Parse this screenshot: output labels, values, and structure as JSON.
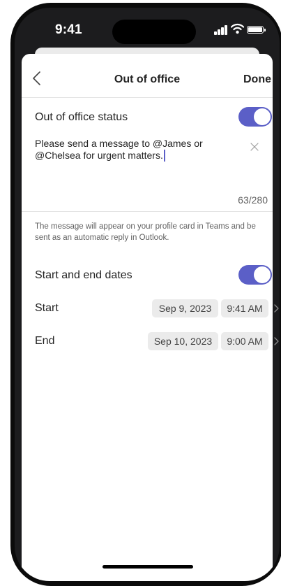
{
  "status_bar": {
    "time": "9:41",
    "icons": [
      "signal-icon",
      "wifi-icon",
      "battery-icon"
    ]
  },
  "nav": {
    "back_icon": "chevron-left-icon",
    "title": "Out of office",
    "done_label": "Done"
  },
  "status_row": {
    "label": "Out of office status",
    "toggle_on": true
  },
  "message": {
    "text": "Please send a message to @James or @Chelsea for urgent matters.",
    "clear_icon": "close-icon",
    "char_count": "63/280"
  },
  "helper_text": "The message will appear on your profile card in Teams and be sent as an automatic reply in Outlook.",
  "dates_row": {
    "label": "Start and end dates",
    "toggle_on": true
  },
  "start": {
    "label": "Start",
    "date": "Sep 9, 2023",
    "time": "9:41 AM"
  },
  "end": {
    "label": "End",
    "date": "Sep 10, 2023",
    "time": "9:00 AM"
  },
  "colors": {
    "accent": "#5b5fc7",
    "chip_bg": "#ebebeb",
    "text_primary": "#242424",
    "text_secondary": "#616161"
  }
}
